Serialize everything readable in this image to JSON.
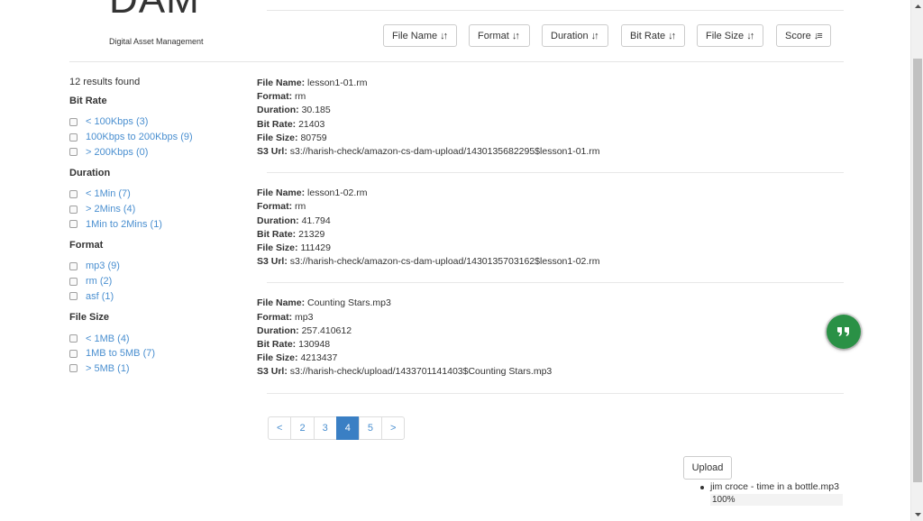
{
  "brand": {
    "title": "DAM",
    "subtitle": "Digital Asset Management"
  },
  "sort_buttons": [
    {
      "label": "File Name",
      "icon": "sort-icon",
      "glyph": "↓↑"
    },
    {
      "label": "Format",
      "icon": "sort-icon",
      "glyph": "↓↑"
    },
    {
      "label": "Duration",
      "icon": "sort-icon",
      "glyph": "↓↑"
    },
    {
      "label": "Bit Rate",
      "icon": "sort-icon",
      "glyph": "↓↑"
    },
    {
      "label": "File Size",
      "icon": "sort-icon",
      "glyph": "↓↑"
    },
    {
      "label": "Score",
      "icon": "sort-descending-icon",
      "glyph": "↓≡"
    }
  ],
  "sidebar": {
    "results_count": "12 results found",
    "facets": [
      {
        "title": "Bit Rate",
        "options": [
          "< 100Kbps (3)",
          "100Kbps to 200Kbps (9)",
          "> 200Kbps (0)"
        ]
      },
      {
        "title": "Duration",
        "options": [
          "< 1Min (7)",
          "> 2Mins (4)",
          "1Min to 2Mins (1)"
        ]
      },
      {
        "title": "Format",
        "options": [
          "mp3 (9)",
          "rm (2)",
          "asf (1)"
        ]
      },
      {
        "title": "File Size",
        "options": [
          "< 1MB (4)",
          "1MB to 5MB (7)",
          "> 5MB (1)"
        ]
      }
    ]
  },
  "field_labels": {
    "file_name": "File Name:",
    "format": "Format:",
    "duration": "Duration:",
    "bit_rate": "Bit Rate:",
    "file_size": "File Size:",
    "s3_url": "S3 Url:"
  },
  "results": [
    {
      "file_name": "lesson1-01.rm",
      "format": "rm",
      "duration": "30.185",
      "bit_rate": "21403",
      "file_size": "80759",
      "s3_url": "s3://harish-check/amazon-cs-dam-upload/1430135682295$lesson1-01.rm"
    },
    {
      "file_name": "lesson1-02.rm",
      "format": "rm",
      "duration": "41.794",
      "bit_rate": "21329",
      "file_size": "111429",
      "s3_url": "s3://harish-check/amazon-cs-dam-upload/1430135703162$lesson1-02.rm"
    },
    {
      "file_name": "Counting Stars.mp3",
      "format": "mp3",
      "duration": "257.410612",
      "bit_rate": "130948",
      "file_size": "4213437",
      "s3_url": "s3://harish-check/upload/1433701141403$Counting Stars.mp3"
    }
  ],
  "pagination": {
    "prev": "<",
    "pages": [
      "2",
      "3",
      "4",
      "5"
    ],
    "active": "4",
    "next": ">"
  },
  "upload": {
    "button_label": "Upload",
    "files": [
      {
        "name": "jim croce - time in a bottle.mp3",
        "progress": 1.0,
        "progress_label": "100%"
      }
    ]
  },
  "chat_button": {
    "icon": "chat-quote-icon",
    "color": "#2a9146"
  },
  "colors": {
    "link": "#4a8fd0",
    "active_page": "#3a7fc4"
  }
}
